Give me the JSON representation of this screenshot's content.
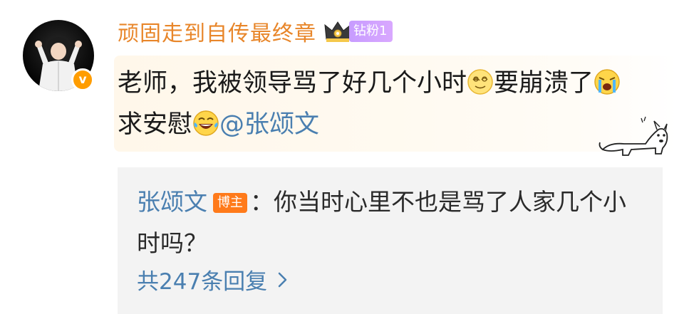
{
  "comment": {
    "username": "顽固走到自传最终章",
    "fan_badge": "钻粉1",
    "verified_mark": "v",
    "text_part1": "老师，我被领导骂了好几个小时",
    "text_part2": "要崩溃了",
    "text_part3": "求安慰",
    "mention": "@张颂文"
  },
  "reply": {
    "author": "张颂文",
    "host_badge": "博主",
    "text": "：你当时心里不也是骂了人家几个小时吗？",
    "more_replies": "共247条回复"
  },
  "colors": {
    "username": "#e8862a",
    "link": "#4a7fb0",
    "fan_badge": "#c79cff",
    "host_badge": "#ff7a1a",
    "verified": "#ff9d00"
  },
  "icons": {
    "avatar": "user-avatar",
    "verified": "verified-v-icon",
    "crown": "crown-icon",
    "emoji1": "dizzy-face-emoji",
    "emoji2": "crying-face-emoji",
    "emoji3": "laughing-tears-emoji",
    "sticker": "dog-sticker",
    "chevron": "chevron-right-icon"
  }
}
